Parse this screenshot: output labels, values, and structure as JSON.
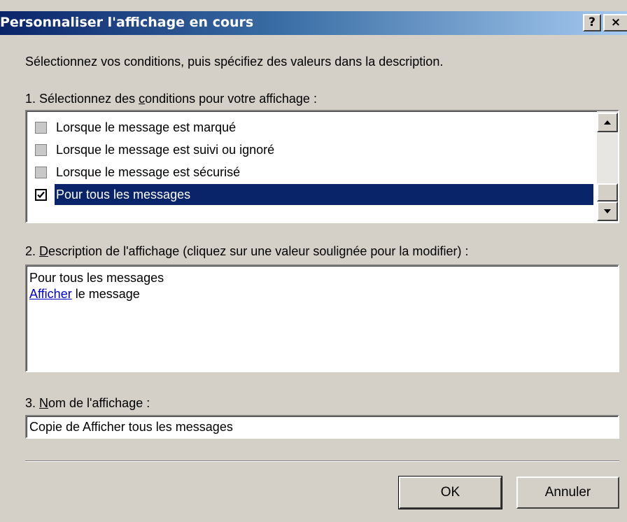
{
  "window": {
    "title": "Personnaliser l'affichage en cours",
    "help_label": "?",
    "close_label": "×"
  },
  "intro": "Sélectionnez vos conditions, puis spécifiez des valeurs dans la description.",
  "conditions": {
    "label_prefix": "1. Sélectionnez des ",
    "label_accel": "c",
    "label_suffix": "onditions pour votre affichage :",
    "items": [
      {
        "label": "Lorsque le message est marqué",
        "checked": false
      },
      {
        "label": "Lorsque le message est suivi ou ignoré",
        "checked": false
      },
      {
        "label": "Lorsque le message est sécurisé",
        "checked": false
      },
      {
        "label": "Pour tous les messages",
        "checked": true,
        "selected": true
      }
    ]
  },
  "description": {
    "label_prefix": "2. ",
    "label_accel": "D",
    "label_suffix": "escription de l'affichage (cliquez sur une valeur soulignée pour la modifier) :",
    "line1": "Pour tous les messages",
    "line2_link": "Afficher",
    "line2_rest": " le message"
  },
  "view_name": {
    "label_prefix": "3. ",
    "label_accel": "N",
    "label_suffix": "om de l'affichage :",
    "value": "Copie de Afficher tous les messages"
  },
  "buttons": {
    "ok": "OK",
    "cancel": "Annuler"
  },
  "colors": {
    "selection": "#0a246a",
    "titlebar_start": "#0a246a",
    "titlebar_end": "#a6caf0",
    "link": "#0000cc",
    "face": "#d4d0c8"
  }
}
